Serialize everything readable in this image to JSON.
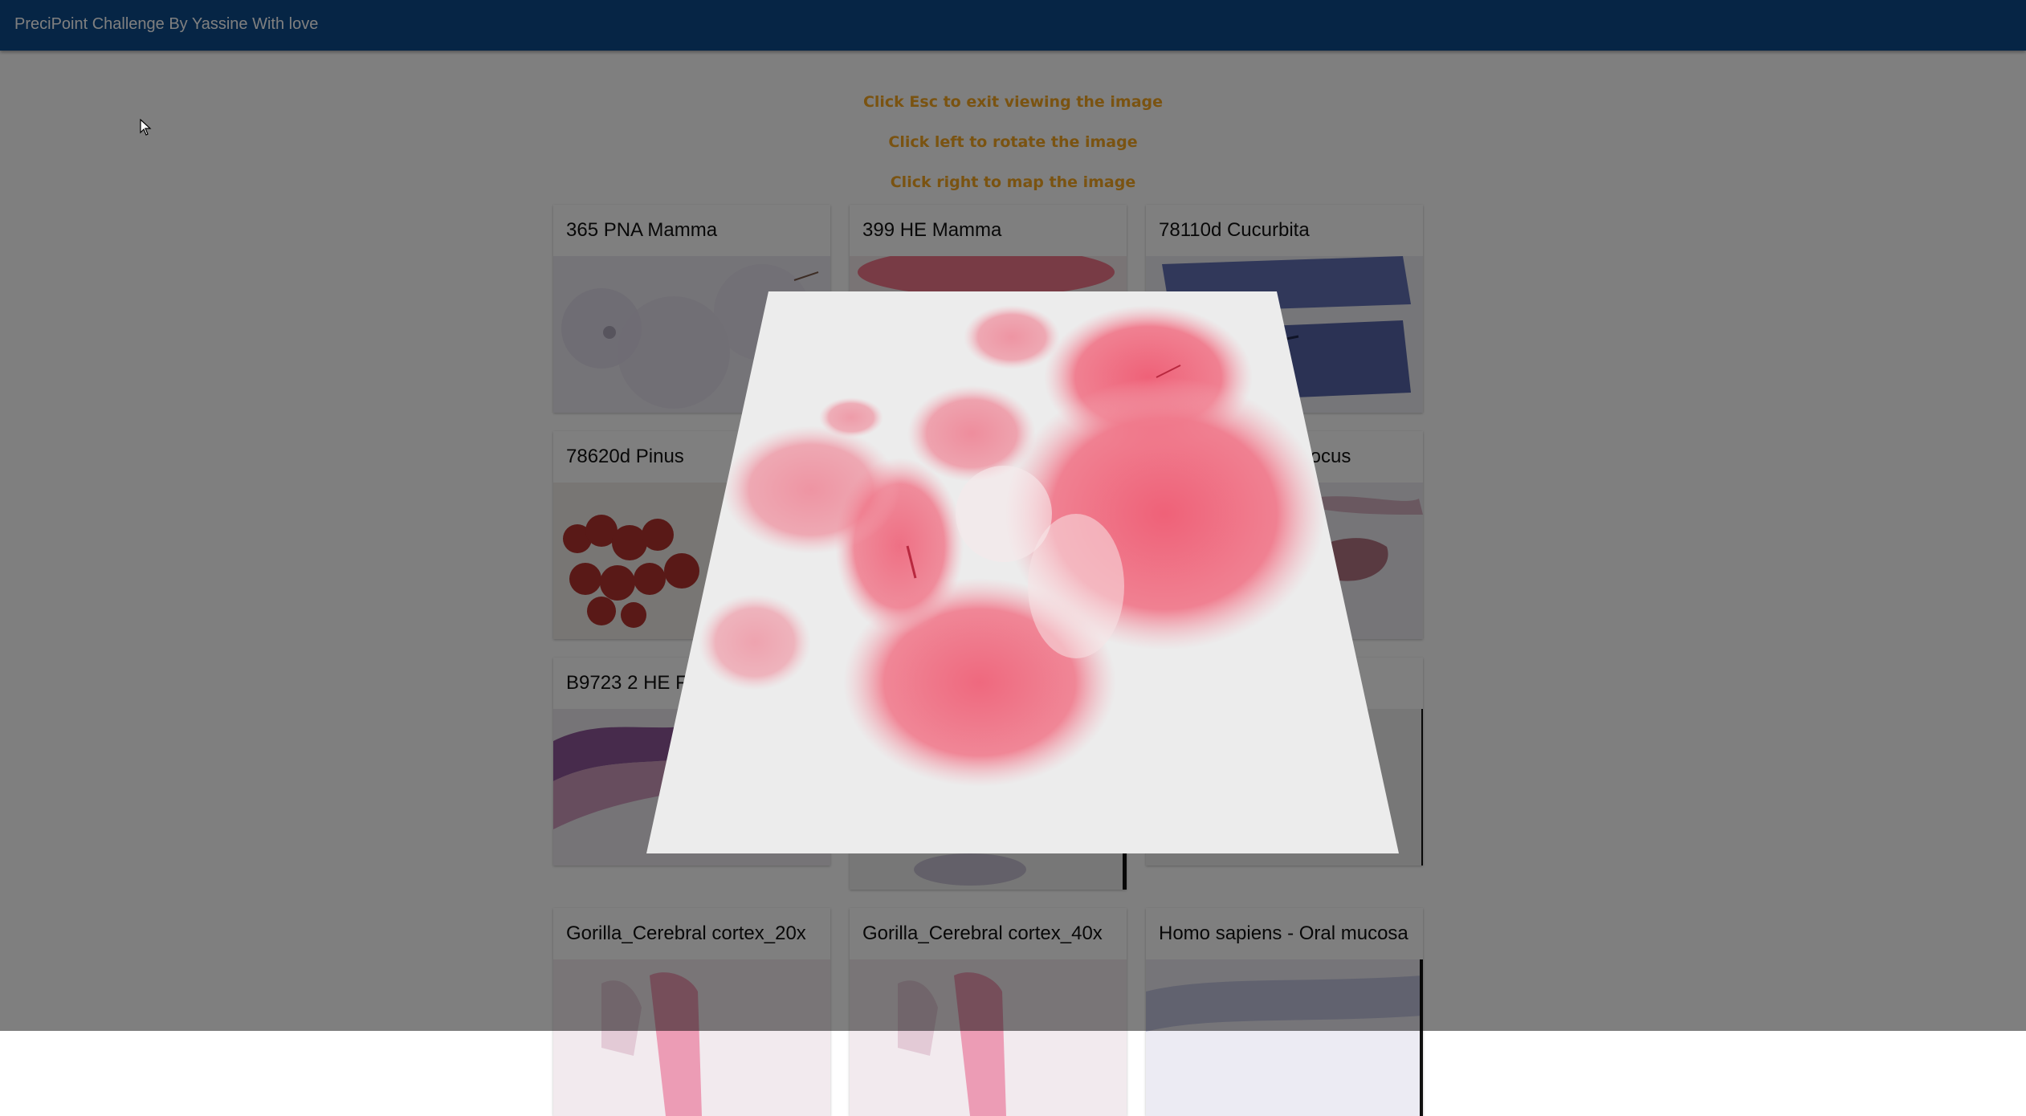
{
  "app": {
    "title": "PreciPoint Challenge By Yassine With love"
  },
  "instructions": [
    "Click Esc to exit viewing the image",
    "Click left to rotate the image",
    "Click right to map the image"
  ],
  "cards": [
    {
      "title": "365 PNA Mamma",
      "thumb": "pale-purple"
    },
    {
      "title": "399 HE Mamma",
      "thumb": "pink-tissue"
    },
    {
      "title": "78110d Cucurbita",
      "thumb": "blue-stem"
    },
    {
      "title": "78620d Pinus",
      "thumb": "red-needles"
    },
    {
      "title": "",
      "thumb": "hidden"
    },
    {
      "title": "Focus",
      "thumb": "pink-strip"
    },
    {
      "title": "B9723 2 HE F",
      "thumb": "purple-mucosa"
    },
    {
      "title": "",
      "thumb": "hidden"
    },
    {
      "title": "",
      "thumb": "hidden"
    },
    {
      "title": "Gorilla_Cerebral cortex_20x",
      "thumb": "pink-cortex"
    },
    {
      "title": "Gorilla_Cerebral cortex_40x",
      "thumb": "pink-cortex"
    },
    {
      "title": "Homo sapiens - Oral mucosa",
      "thumb": "blue-mucosa"
    }
  ],
  "viewer": {
    "image": "HE stained tissue slide (pink)",
    "state": "rotated-3d"
  },
  "colors": {
    "appbar": "#0d4a8a",
    "instruction": "#f5a623",
    "overlay": "rgba(0,0,0,0.5)",
    "tissue": "#ef5a72"
  }
}
